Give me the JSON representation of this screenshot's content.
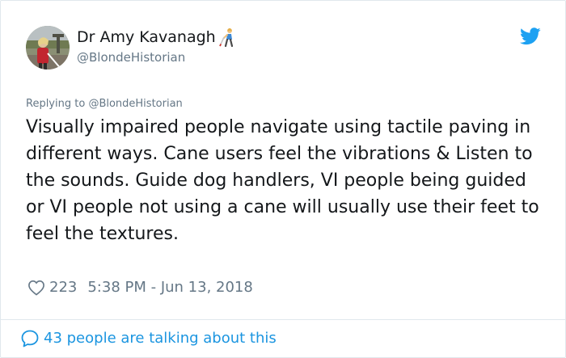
{
  "author": {
    "name": "Dr Amy Kavanagh",
    "name_emoji": "person-with-white-cane-emoji",
    "handle": "@BlondeHistorian",
    "avatar": "profile-photo"
  },
  "brand": {
    "icon": "twitter-bird-icon",
    "color": "#1da1f2"
  },
  "reply_context": {
    "prefix": "Replying to ",
    "handle": "@BlondeHistorian"
  },
  "tweet": {
    "text": "Visually impaired people navigate using tactile paving in different ways. Cane users feel the vibrations & Listen to the sounds. Guide dog handlers, VI people being guided or VI people not using a cane will usually use their feet to feel the textures."
  },
  "meta": {
    "like_icon": "heart-icon",
    "likes": "223",
    "timestamp": "5:38 PM - Jun 13, 2018"
  },
  "footer": {
    "icon": "speech-bubble-icon",
    "talking": "43 people are talking about this",
    "link_color": "#1b95e0"
  }
}
